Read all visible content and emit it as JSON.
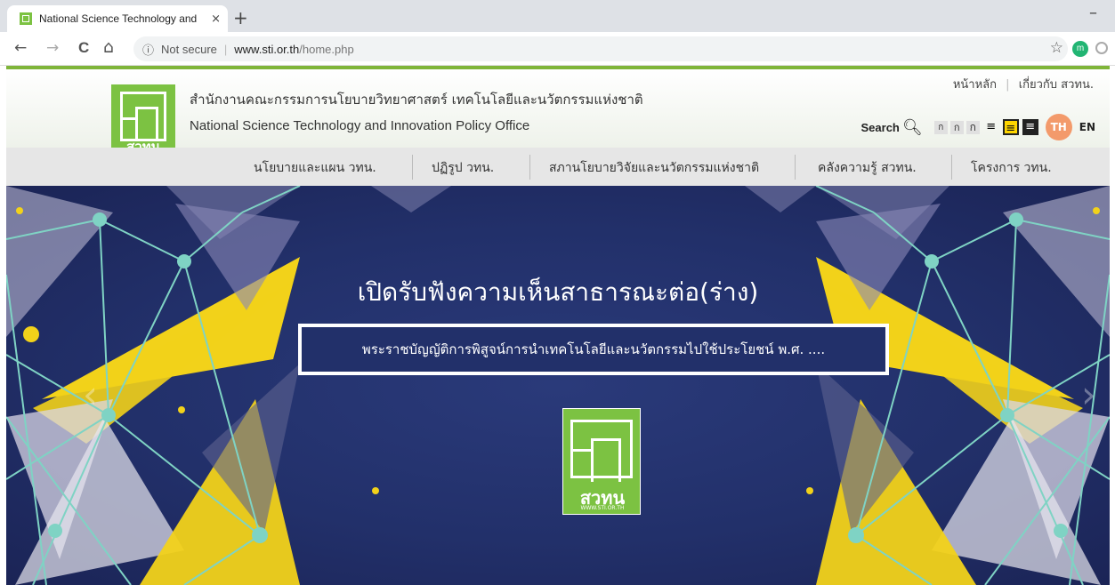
{
  "browser": {
    "tab_title": "National Science Technology and",
    "tab_close": "×",
    "new_tab": "+",
    "minimize": "–",
    "back": "←",
    "forward": "→",
    "reload": "C",
    "home": "⌂",
    "security": "ⓘ",
    "not_secure": "Not secure",
    "separator": "|",
    "url_host": "www.sti.or.th",
    "url_path": "/home.php",
    "bookmark": "☆",
    "ext_letter": "m"
  },
  "site": {
    "logo_text": "สวทน",
    "logo_url": "WWW.STI.OR.TH",
    "org_name_th": "สำนักงานคณะกรรมการนโยบายวิทยาศาสตร์ เทคโนโลยีและนวัตกรรมแห่งชาติ",
    "org_name_en": "National Science Technology and Innovation Policy Office",
    "top_links": [
      "หน้าหลัก",
      "เกี่ยวกับ สวทน."
    ],
    "search_label": "Search",
    "font_sizes": [
      "ก",
      "ก",
      "ก"
    ],
    "lang_th": "TH",
    "lang_en": "EN"
  },
  "nav": {
    "items": [
      "นโยบายและแผน วทน.",
      "ปฏิรูป วทน.",
      "สภานโยบายวิจัยและนวัตกรรมแห่งชาติ",
      "คลังความรู้ สวทน.",
      "โครงการ วทน."
    ]
  },
  "banner": {
    "title": "เปิดรับฟังความเห็นสาธารณะต่อ(ร่าง)",
    "subtitle": "พระราชบัญญัติการพิสูจน์การนำเทคโนโลยีและนวัตกรรมไปใช้ประโยชน์ พ.ศ. ....",
    "prev": "‹",
    "next": "›"
  },
  "colors": {
    "brand_green": "#7cc242",
    "banner_bg": "#22306a",
    "accent_yellow": "#f2d21a",
    "lang_active": "#f39a6b"
  }
}
